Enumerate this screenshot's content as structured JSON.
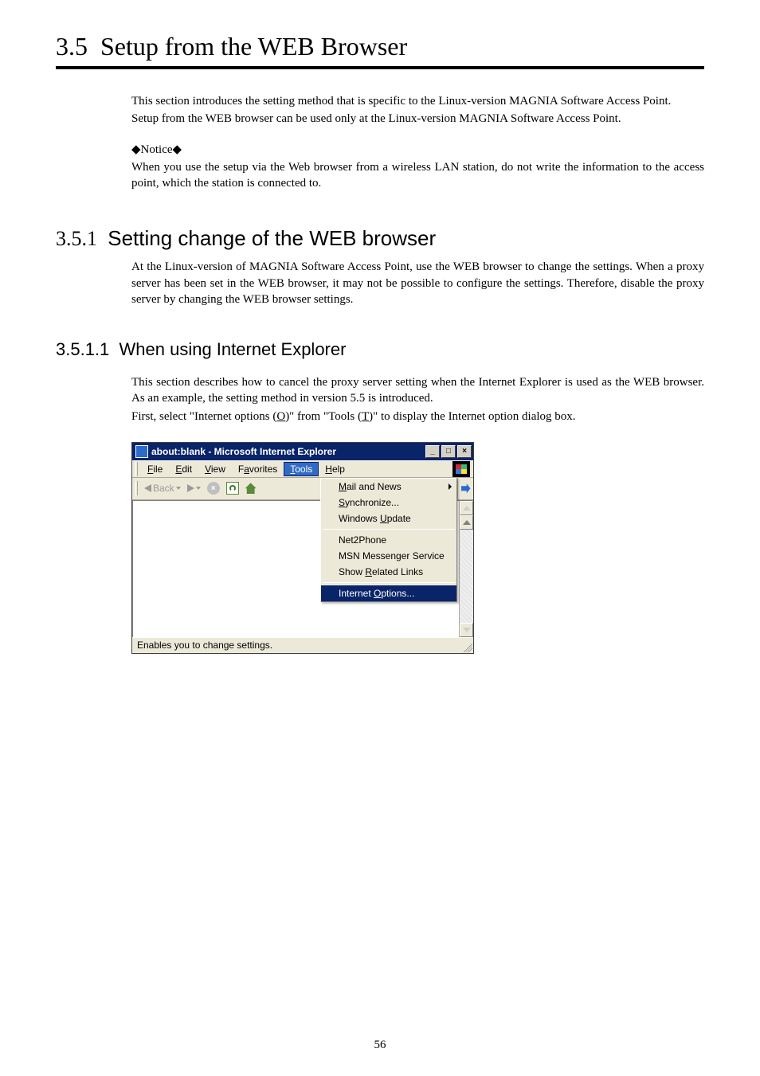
{
  "section": {
    "number": "3.5",
    "title": "Setup from the WEB Browser"
  },
  "intro": {
    "p1": "This section introduces the setting method that is specific to the Linux-version MAGNIA Software Access Point.",
    "p2": "Setup from the WEB browser can be used only at the Linux-version MAGNIA Software Access Point.",
    "notice_label": "◆Notice◆",
    "notice_text": "When you use the setup via the Web browser from a wireless LAN station, do not write the information to the access point, which the station is connected to."
  },
  "sub1": {
    "number": "3.5.1",
    "title": "Setting change of the WEB browser",
    "p1": "At the Linux-version of MAGNIA Software Access Point, use the WEB browser to change the settings.  When a proxy server has been set in the WEB browser, it may not be possible to configure the settings.  Therefore, disable the proxy server by changing the WEB browser settings."
  },
  "sub2": {
    "number": "3.5.1.1",
    "title": "When using Internet Explorer",
    "p1": "This section describes how to cancel the proxy server setting when the Internet Explorer is used as the WEB browser.  As an example, the setting method in version 5.5 is introduced.",
    "p2_prefix": "First, select \"Internet options (",
    "p2_o": "O",
    "p2_mid": ")\" from \"Tools (",
    "p2_t": "T",
    "p2_suffix": ")\" to display the Internet option dialog box."
  },
  "ie": {
    "title": "about:blank - Microsoft Internet Explorer",
    "minimize": "_",
    "maximize": "□",
    "close": "×",
    "menu": {
      "file": "File",
      "edit": "Edit",
      "view": "View",
      "favorites": "Favorites",
      "tools": "Tools",
      "help": "Help"
    },
    "toolbar": {
      "back": "Back"
    },
    "dropdown": {
      "mail": "Mail and News",
      "sync": "Synchronize...",
      "update": "Windows Update",
      "net2phone": "Net2Phone",
      "msn": "MSN Messenger Service",
      "related": "Show Related Links",
      "options": "Internet Options..."
    },
    "status": "Enables you to change settings."
  },
  "page_number": "56"
}
